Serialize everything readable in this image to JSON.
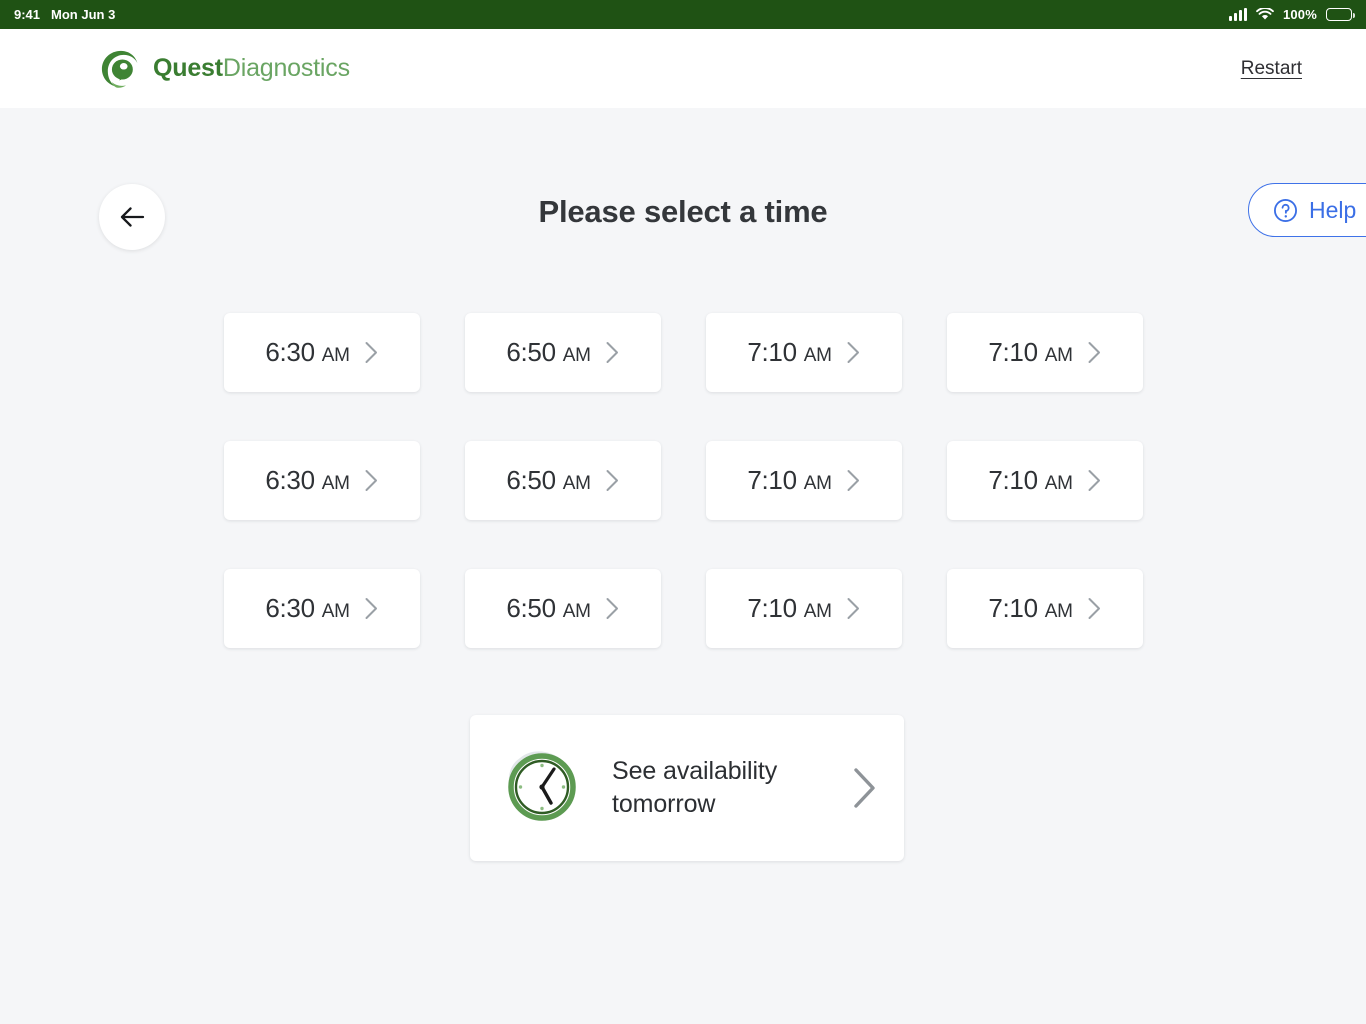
{
  "status_bar": {
    "time": "9:41",
    "date": "Mon Jun 3",
    "battery_percent": "100%",
    "signal_icon": "signal-bars-icon",
    "wifi_icon": "wifi-icon",
    "battery_icon": "battery-full-icon",
    "background_color": "#1f5214"
  },
  "header": {
    "logo_primary": "Quest",
    "logo_secondary": "Diagnostics",
    "logo_icon": "quest-swirl-logo-icon",
    "restart_label": "Restart",
    "brand_color": "#3a7d31",
    "brand_color_light": "#6aa563"
  },
  "main": {
    "title": "Please select a time",
    "back_icon": "arrow-left-icon",
    "help": {
      "label": "Help",
      "icon": "question-circle-icon",
      "color": "#3b6fe6"
    },
    "slots": [
      {
        "time": "6:30",
        "meridiem": "AM"
      },
      {
        "time": "6:50",
        "meridiem": "AM"
      },
      {
        "time": "7:10",
        "meridiem": "AM"
      },
      {
        "time": "7:10",
        "meridiem": "AM"
      },
      {
        "time": "6:30",
        "meridiem": "AM"
      },
      {
        "time": "6:50",
        "meridiem": "AM"
      },
      {
        "time": "7:10",
        "meridiem": "AM"
      },
      {
        "time": "7:10",
        "meridiem": "AM"
      },
      {
        "time": "6:30",
        "meridiem": "AM"
      },
      {
        "time": "6:50",
        "meridiem": "AM"
      },
      {
        "time": "7:10",
        "meridiem": "AM"
      },
      {
        "time": "7:10",
        "meridiem": "AM"
      }
    ],
    "tomorrow": {
      "label": "See availability tomorrow",
      "icon": "clock-icon",
      "chevron_icon": "chevron-right-icon"
    }
  }
}
